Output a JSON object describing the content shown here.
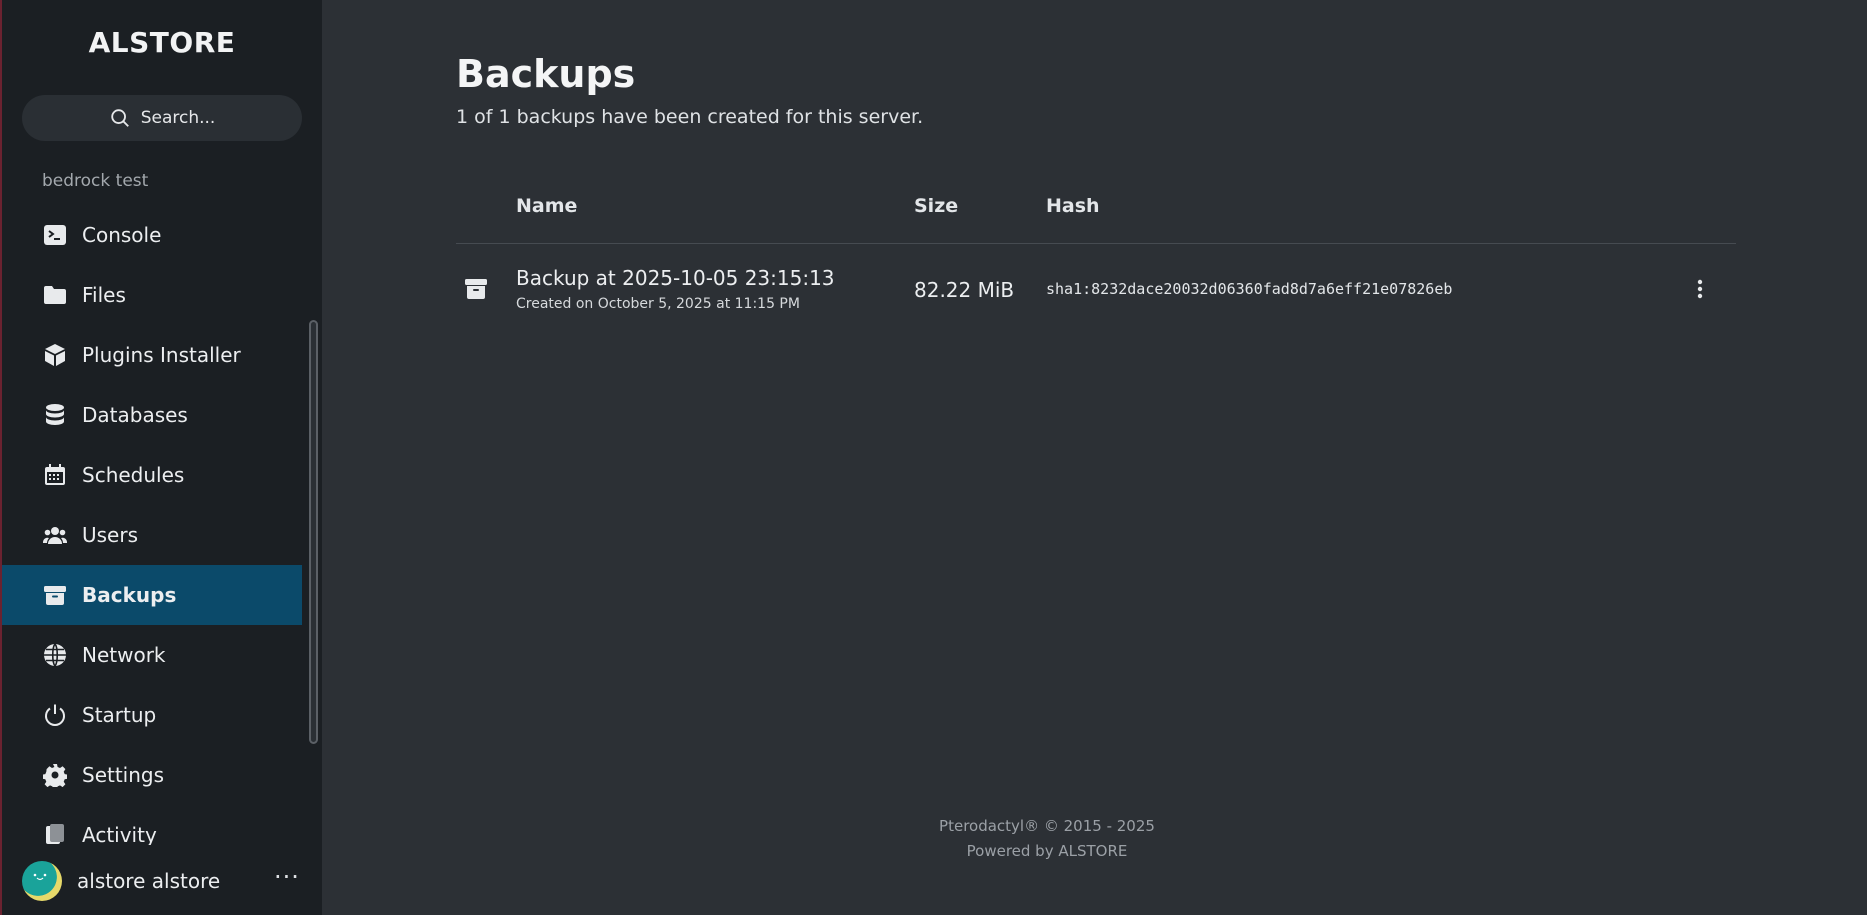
{
  "sidebar": {
    "brand": "ALSTORE",
    "search_label": "Search...",
    "server_name": "bedrock test",
    "items": [
      {
        "label": "Console",
        "icon": "terminal-icon"
      },
      {
        "label": "Files",
        "icon": "folder-icon"
      },
      {
        "label": "Plugins Installer",
        "icon": "cube-icon"
      },
      {
        "label": "Databases",
        "icon": "database-icon"
      },
      {
        "label": "Schedules",
        "icon": "calendar-icon"
      },
      {
        "label": "Users",
        "icon": "users-icon"
      },
      {
        "label": "Backups",
        "icon": "archive-icon",
        "active": true
      },
      {
        "label": "Network",
        "icon": "globe-icon"
      },
      {
        "label": "Startup",
        "icon": "power-icon"
      },
      {
        "label": "Settings",
        "icon": "gear-icon"
      },
      {
        "label": "Activity",
        "icon": "activity-icon"
      }
    ],
    "user": {
      "name": "alstore alstore",
      "more": "···"
    }
  },
  "main": {
    "title": "Backups",
    "subtitle": "1 of 1 backups have been created for this server.",
    "columns": {
      "name": "Name",
      "size": "Size",
      "hash": "Hash"
    },
    "rows": [
      {
        "name": "Backup at 2025-10-05 23:15:13",
        "created": "Created on October 5, 2025 at 11:15 PM",
        "size": "82.22 MiB",
        "hash": "sha1:8232dace20032d06360fad8d7a6eff21e07826eb"
      }
    ]
  },
  "footer": {
    "line1": "Pterodactyl® © 2015 - 2025",
    "line2": "Powered by ALSTORE"
  },
  "colors": {
    "sidebar_bg": "#1b1f23",
    "main_bg": "#2c3035",
    "active_item": "#0b4a6a"
  }
}
